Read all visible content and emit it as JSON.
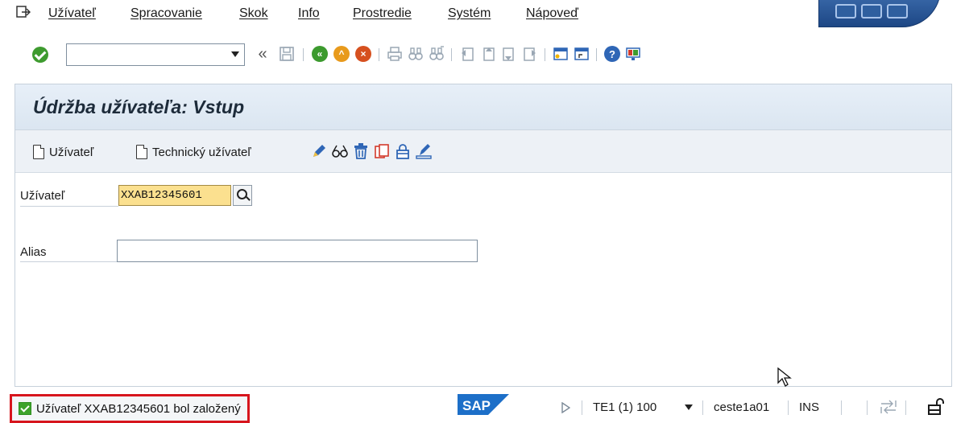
{
  "menu": {
    "items": [
      "Užívateľ",
      "Spracovanie",
      "Skok",
      "Info",
      "Prostredie",
      "Systém",
      "Nápoveď"
    ]
  },
  "toolbar": {
    "command_value": "",
    "icons": [
      "enter-check-icon",
      "command-dropdown",
      "collapse-chevron-icon",
      "save-icon",
      "back-icon",
      "exit-icon",
      "cancel-icon",
      "print-icon",
      "find-icon",
      "find-next-icon",
      "first-page-icon",
      "previous-page-icon",
      "next-page-icon",
      "last-page-icon",
      "new-session-icon",
      "shortcut-icon",
      "help-icon",
      "customize-layout-icon"
    ]
  },
  "screen": {
    "title": "Údržba užívateľa: Vstup",
    "app_toolbar": {
      "create_user_label": "Užívateľ",
      "create_technical_user_label": "Technický užívateľ"
    },
    "fields": {
      "user_label": "Užívateľ",
      "user_value": "XXAB12345601",
      "alias_label": "Alias",
      "alias_value": ""
    }
  },
  "status": {
    "message": "Užívateľ XXAB12345601 bol založený",
    "logo": "SAP",
    "system": "TE1 (1) 100",
    "server": "ceste1a01",
    "mode": "INS"
  },
  "colors": {
    "accent": "#2f66b6",
    "ok_green": "#3e9b2f",
    "highlight_field": "#fbe08f",
    "status_border": "#d7151d"
  }
}
